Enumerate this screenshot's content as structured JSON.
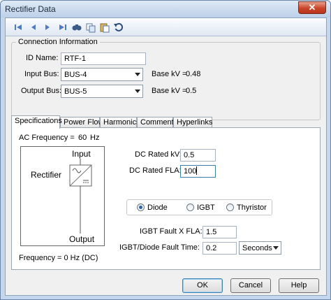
{
  "window": {
    "title": "Rectifier Data",
    "close_label": "✕"
  },
  "toolbar": {
    "icons": [
      "first-record-icon",
      "previous-record-icon",
      "next-record-icon",
      "last-record-icon",
      "find-icon",
      "copy-icon",
      "paste-icon",
      "undo-icon"
    ]
  },
  "connection": {
    "title": "Connection Information",
    "id_label": "ID Name:",
    "id_value": "RTF-1",
    "input_bus_label": "Input Bus:",
    "input_bus_value": "BUS-4",
    "input_basekv_label": "Base kV =",
    "input_basekv_value": "0.48",
    "output_bus_label": "Output Bus:",
    "output_bus_value": "BUS-5",
    "output_basekv_label": "Base kV =",
    "output_basekv_value": "0.5"
  },
  "tabs": [
    {
      "label": "Specifications",
      "active": true
    },
    {
      "label": "Power Flow",
      "active": false
    },
    {
      "label": "Harmonics",
      "active": false
    },
    {
      "label": "Comments",
      "active": false
    },
    {
      "label": "Hyperlinks",
      "active": false
    }
  ],
  "specifications": {
    "ac_frequency_label": "AC Frequency =",
    "ac_frequency_value": "60",
    "ac_frequency_unit": "Hz",
    "diagram": {
      "name": "Rectifier",
      "input_label": "Input",
      "output_label": "Output"
    },
    "frequency_note": "Frequency = 0 Hz (DC)",
    "dc_rated_kv_label": "DC Rated kV:",
    "dc_rated_kv_value": "0.5",
    "dc_rated_fla_label": "DC Rated FLA:",
    "dc_rated_fla_value": "100",
    "device_types": [
      {
        "label": "Diode",
        "checked": true
      },
      {
        "label": "IGBT",
        "checked": false
      },
      {
        "label": "Thyristor",
        "checked": false
      }
    ],
    "igbt_fault_label": "IGBT Fault X FLA:",
    "igbt_fault_value": "1.5",
    "fault_time_label": "IGBT/Diode Fault Time:",
    "fault_time_value": "0.2",
    "fault_time_unit": "Seconds"
  },
  "buttons": {
    "ok": "OK",
    "cancel": "Cancel",
    "help": "Help"
  },
  "colors": {
    "accent": "#2b5fa6",
    "titlebar": "#c5d7ec",
    "close": "#c9452a"
  }
}
